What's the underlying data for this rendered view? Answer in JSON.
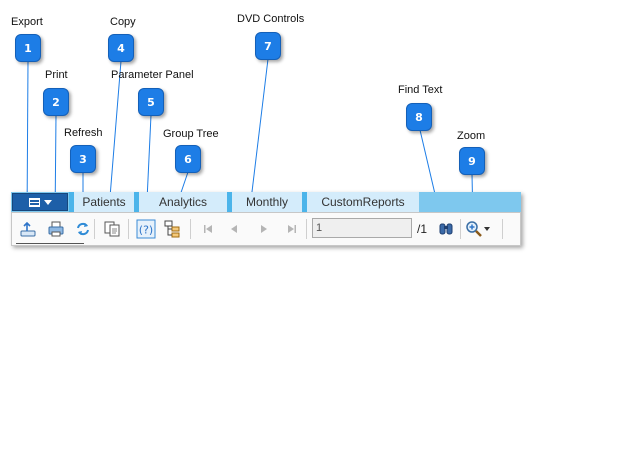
{
  "callouts": [
    {
      "num": "1",
      "label": "Export"
    },
    {
      "num": "2",
      "label": "Print"
    },
    {
      "num": "3",
      "label": "Refresh"
    },
    {
      "num": "4",
      "label": "Copy"
    },
    {
      "num": "5",
      "label": "Parameter Panel"
    },
    {
      "num": "6",
      "label": "Group Tree"
    },
    {
      "num": "7",
      "label": "DVD Controls"
    },
    {
      "num": "8",
      "label": "Find Text"
    },
    {
      "num": "9",
      "label": "Zoom"
    }
  ],
  "tabs": [
    "Patients",
    "Analytics",
    "Monthly",
    "CustomReports"
  ],
  "pager": {
    "current": "1",
    "total": "/1"
  },
  "colors": {
    "badge": "#1d7de6",
    "tabstrip": "#7ec8ee",
    "tab": "#d4ecfb",
    "leader": "#1d7de6"
  },
  "icons": [
    "export-icon",
    "print-icon",
    "refresh-icon",
    "copy-icon",
    "parameter-panel-icon",
    "group-tree-icon",
    "first-page-icon",
    "previous-page-icon",
    "next-page-icon",
    "last-page-icon",
    "find-text-icon",
    "zoom-icon",
    "zoom-dropdown-arrow-icon"
  ]
}
